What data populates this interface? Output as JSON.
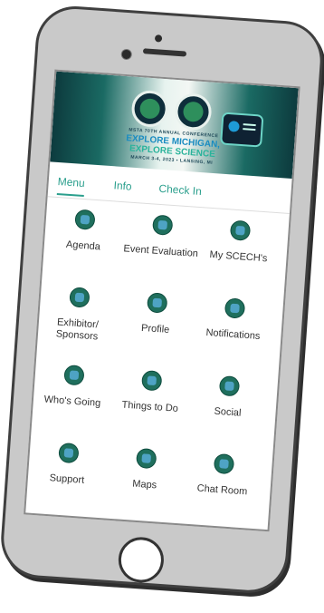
{
  "banner": {
    "line1": "MSTA 70TH ANNUAL CONFERENCE",
    "line2": "EXPLORE MICHIGAN,",
    "line3": "EXPLORE SCIENCE",
    "line4": "MARCH 3-4, 2023 • LANSING, MI"
  },
  "tabs": [
    {
      "label": "Menu",
      "active": true
    },
    {
      "label": "Info",
      "active": false
    },
    {
      "label": "Check In",
      "active": false
    }
  ],
  "menu": [
    {
      "label": "Agenda",
      "icon": "agenda-icon"
    },
    {
      "label": "Event Evaluation",
      "icon": "evaluation-icon"
    },
    {
      "label": "My SCECH's",
      "icon": "scech-icon"
    },
    {
      "label": "Exhibitor/ Sponsors",
      "icon": "exhibitor-icon"
    },
    {
      "label": "Profile",
      "icon": "profile-icon"
    },
    {
      "label": "Notifications",
      "icon": "notifications-icon"
    },
    {
      "label": "Who's Going",
      "icon": "whos-going-icon"
    },
    {
      "label": "Things to Do",
      "icon": "things-to-do-icon"
    },
    {
      "label": "Social",
      "icon": "social-icon"
    },
    {
      "label": "Support",
      "icon": "support-icon"
    },
    {
      "label": "Maps",
      "icon": "map-pin-icon"
    },
    {
      "label": "Chat Room",
      "icon": "chat-room-icon"
    }
  ],
  "colors": {
    "accent": "#2b9f8d",
    "icon_bg": "#1f6f5d"
  }
}
